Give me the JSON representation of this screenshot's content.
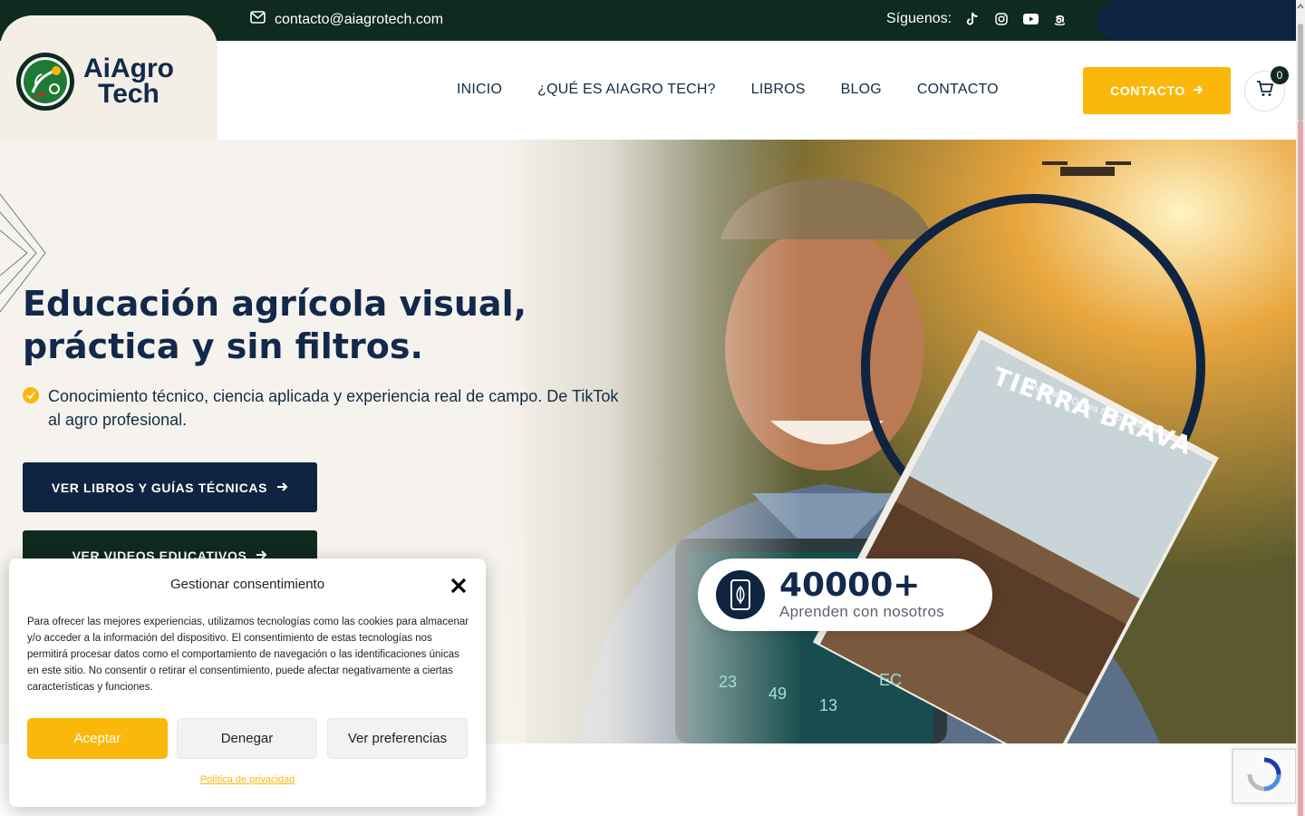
{
  "topbar": {
    "email": "contacto@aiagrotech.com",
    "follow_label": "Síguenos:",
    "socials": [
      "tiktok-icon",
      "instagram-icon",
      "youtube-icon",
      "amazon-icon"
    ]
  },
  "logo": {
    "line1": "AiAgro",
    "line2": "Tech"
  },
  "nav": {
    "items": [
      "INICIO",
      "¿QUÉ ES AIAGRO TECH?",
      "LIBROS",
      "BLOG",
      "CONTACTO"
    ]
  },
  "header": {
    "cta_label": "CONTACTO",
    "cart_count": "0"
  },
  "hero": {
    "title": "Educación agrícola visual, práctica y sin filtros.",
    "bullet": "Conocimiento técnico, ciencia aplicada y experiencia real de campo. De TikTok al agro profesional.",
    "btn_books": "VER LIBROS Y GUÍAS TÉCNICAS",
    "btn_videos": "VER VIDEOS EDUCATIVOS",
    "book_title": "TIERRA BRAVA",
    "book_subtitle": "Manual PRO para Suelos Difíciles",
    "tablet_readings": [
      "23",
      "49",
      "13",
      "EC"
    ],
    "stat_number": "40000+",
    "stat_label": "Aprenden con nosotros"
  },
  "cookie": {
    "title": "Gestionar consentimiento",
    "text": "Para ofrecer las mejores experiencias, utilizamos tecnologías como las cookies para almacenar y/o acceder a la información del dispositivo. El consentimiento de estas tecnologías nos permitirá procesar datos como el comportamiento de navegación o las identificaciones únicas en este sitio. No consentir o retirar el consentimiento, puede afectar negativamente a ciertas características y funciones.",
    "accept": "Aceptar",
    "deny": "Denegar",
    "preferences": "Ver preferencias",
    "policy": "Política de privacidad"
  },
  "colors": {
    "brand_green": "#0f2a1f",
    "brand_navy": "#0f2440",
    "accent_yellow": "#fbb80a",
    "cream": "#f3eee6"
  }
}
